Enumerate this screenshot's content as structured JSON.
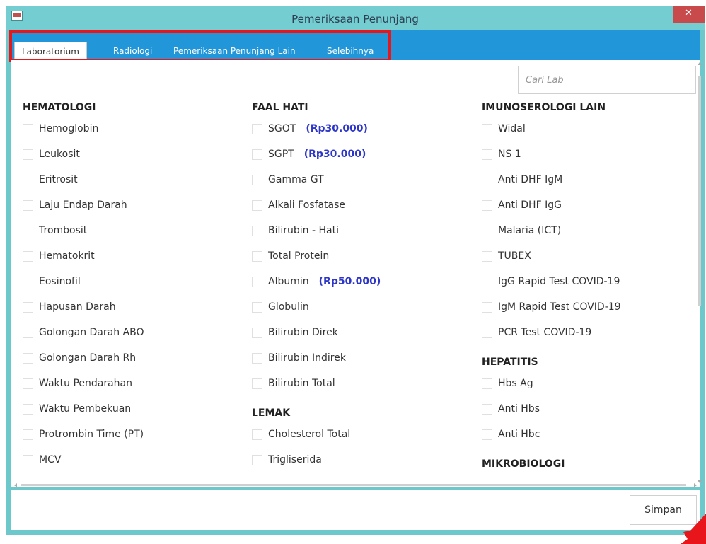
{
  "window": {
    "title": "Pemeriksaan Penunjang",
    "close_label": "✕"
  },
  "tabs": [
    {
      "label": "Laboratorium",
      "active": true
    },
    {
      "label": "Radiologi"
    },
    {
      "label": "Pemeriksaan Penunjang Lain"
    },
    {
      "label": "Selebihnya"
    }
  ],
  "search": {
    "placeholder": "Cari Lab"
  },
  "columns": [
    {
      "groups": [
        {
          "heading": "HEMATOLOGI",
          "items": [
            {
              "label": "Hemoglobin"
            },
            {
              "label": "Leukosit"
            },
            {
              "label": "Eritrosit"
            },
            {
              "label": "Laju Endap Darah"
            },
            {
              "label": "Trombosit"
            },
            {
              "label": "Hematokrit"
            },
            {
              "label": "Eosinofil"
            },
            {
              "label": "Hapusan Darah"
            },
            {
              "label": "Golongan Darah ABO"
            },
            {
              "label": "Golongan Darah Rh"
            },
            {
              "label": "Waktu Pendarahan"
            },
            {
              "label": "Waktu Pembekuan"
            },
            {
              "label": "Protrombin Time (PT)"
            },
            {
              "label": "MCV"
            }
          ]
        }
      ]
    },
    {
      "groups": [
        {
          "heading": "FAAL HATI",
          "items": [
            {
              "label": "SGOT",
              "price": "(Rp30.000)"
            },
            {
              "label": "SGPT",
              "price": "(Rp30.000)"
            },
            {
              "label": "Gamma GT"
            },
            {
              "label": "Alkali Fosfatase"
            },
            {
              "label": "Bilirubin - Hati"
            },
            {
              "label": "Total Protein"
            },
            {
              "label": "Albumin",
              "price": "(Rp50.000)"
            },
            {
              "label": "Globulin"
            },
            {
              "label": "Bilirubin Direk"
            },
            {
              "label": "Bilirubin Indirek"
            },
            {
              "label": "Bilirubin Total"
            }
          ]
        },
        {
          "heading": "LEMAK",
          "items": [
            {
              "label": "Cholesterol Total"
            },
            {
              "label": "Trigliserida"
            }
          ]
        }
      ]
    },
    {
      "groups": [
        {
          "heading": "IMUNOSEROLOGI LAIN",
          "items": [
            {
              "label": "Widal"
            },
            {
              "label": "NS 1"
            },
            {
              "label": "Anti DHF IgM"
            },
            {
              "label": "Anti DHF IgG"
            },
            {
              "label": "Malaria (ICT)"
            },
            {
              "label": "TUBEX"
            },
            {
              "label": "IgG Rapid Test COVID-19"
            },
            {
              "label": "IgM Rapid Test COVID-19"
            },
            {
              "label": "PCR Test COVID-19"
            }
          ]
        },
        {
          "heading": "HEPATITIS",
          "items": [
            {
              "label": "Hbs Ag"
            },
            {
              "label": "Anti Hbs"
            },
            {
              "label": "Anti Hbc"
            }
          ]
        },
        {
          "heading": "MIKROBIOLOGI",
          "items": []
        }
      ]
    }
  ],
  "footer": {
    "save_label": "Simpan"
  },
  "colors": {
    "titlebar": "#74cdd0",
    "tabbar": "#2196d8",
    "price": "#2d36c8",
    "highlight": "#e8161b",
    "close": "#c84a4a"
  }
}
